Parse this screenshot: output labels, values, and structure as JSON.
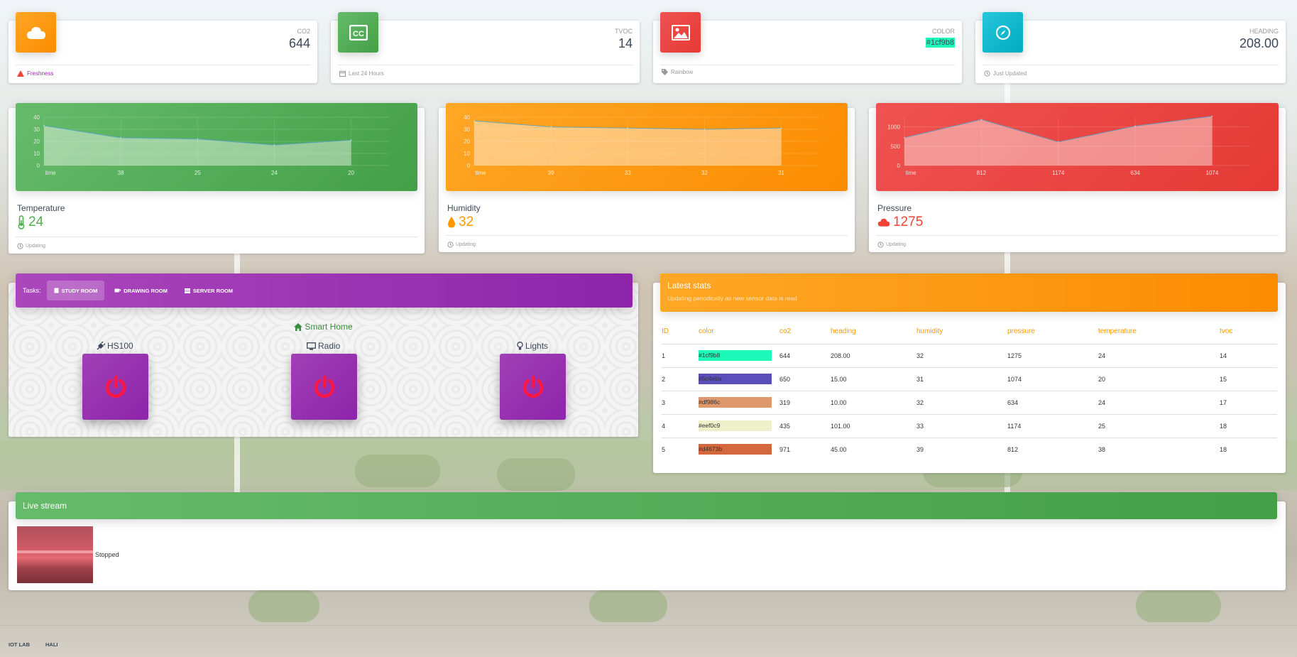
{
  "stat_cards": [
    {
      "category": "CO2",
      "value": "644",
      "footer": "Freshness",
      "icon": "cloud-icon",
      "color": "#ff9800"
    },
    {
      "category": "TVOC",
      "value": "14",
      "footer": "Last 24 Hours",
      "icon": "cc-icon",
      "color": "#4caf50"
    },
    {
      "category": "Color",
      "value": "#1cf9b8",
      "footer": "Rainbow",
      "icon": "image-icon",
      "color": "#f44336"
    },
    {
      "category": "Heading",
      "value": "208.00",
      "footer": "Just Updated",
      "icon": "compass-icon",
      "color": "#00bcd4"
    }
  ],
  "charts": [
    {
      "label": "Temperature",
      "value": "24",
      "footer": "Updating",
      "icon": "thermometer-icon",
      "color": "#4caf50"
    },
    {
      "label": "Humidity",
      "value": "32",
      "footer": "Updating",
      "icon": "drop-icon",
      "color": "#ff9800"
    },
    {
      "label": "Pressure",
      "value": "1275",
      "footer": "Updating",
      "icon": "cloud-icon",
      "color": "#f44336"
    }
  ],
  "chart_data": [
    {
      "type": "area",
      "title": "",
      "x": [
        "time",
        "38",
        "25",
        "24",
        "20"
      ],
      "values": [
        33,
        23,
        22,
        17,
        21
      ],
      "yticks": [
        "40",
        "30",
        "20",
        "10",
        "0"
      ],
      "ylim": [
        0,
        40
      ],
      "grid": true
    },
    {
      "type": "area",
      "title": "",
      "x": [
        "time",
        "39",
        "33",
        "32",
        "31"
      ],
      "values": [
        37,
        32,
        31,
        30,
        31
      ],
      "yticks": [
        "40",
        "30",
        "20",
        "10",
        "0"
      ],
      "ylim": [
        0,
        40
      ],
      "grid": true
    },
    {
      "type": "area",
      "title": "",
      "x": [
        "time",
        "812",
        "1174",
        "634",
        "1074"
      ],
      "values": [
        720,
        1190,
        610,
        1020,
        1275
      ],
      "yticks": [
        "1000",
        "500",
        "0"
      ],
      "ylim": [
        0,
        1250
      ],
      "grid": true
    }
  ],
  "tasks": {
    "label": "Tasks:",
    "tabs": [
      {
        "label": "Study Room",
        "icon": "book-icon",
        "active": true
      },
      {
        "label": "Drawing Room",
        "icon": "coffee-icon",
        "active": false
      },
      {
        "label": "Server Room",
        "icon": "server-icon",
        "active": false
      }
    ]
  },
  "smart_home": {
    "title": "Smart Home",
    "devices": [
      {
        "label": "HS100",
        "icon": "plug-icon"
      },
      {
        "label": "Radio",
        "icon": "monitor-icon"
      },
      {
        "label": "Lights",
        "icon": "bulb-icon"
      }
    ]
  },
  "latest_stats": {
    "title": "Latest stats",
    "subtitle": "Updating periodically as new sensor data is read",
    "columns": [
      "ID",
      "color",
      "co2",
      "heading",
      "humidity",
      "pressure",
      "temperature",
      "tvoc"
    ],
    "rows": [
      [
        "1",
        "#1cf9b8",
        "644",
        "208.00",
        "32",
        "1275",
        "24",
        "14"
      ],
      [
        "2",
        "#5c4eba",
        "650",
        "15.00",
        "31",
        "1074",
        "20",
        "15"
      ],
      [
        "3",
        "#df986c",
        "319",
        "10.00",
        "32",
        "634",
        "24",
        "17"
      ],
      [
        "4",
        "#eef0c9",
        "435",
        "101.00",
        "33",
        "1174",
        "25",
        "18"
      ],
      [
        "5",
        "#d4673b",
        "971",
        "45.00",
        "39",
        "812",
        "38",
        "18"
      ]
    ]
  },
  "live_stream": {
    "title": "Live stream",
    "status": "Stopped"
  },
  "footer": {
    "links": [
      "IOT LAB",
      "HALI"
    ]
  }
}
